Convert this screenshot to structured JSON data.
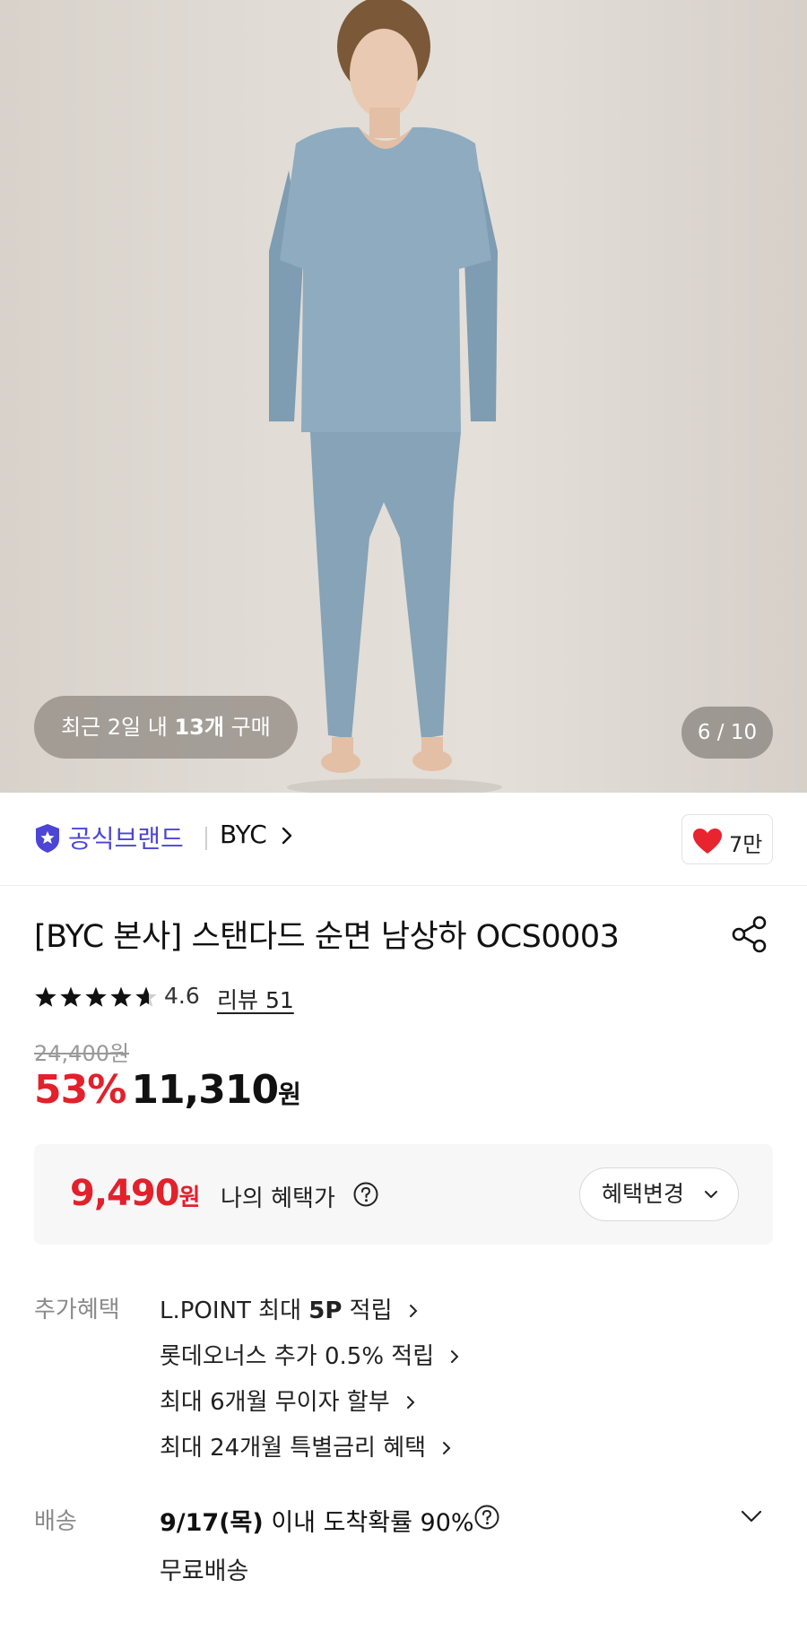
{
  "hero": {
    "recent_prefix": "최근 2일 내 ",
    "recent_count": "13개",
    "recent_suffix": " 구매",
    "page_indicator": "6 / 10"
  },
  "brand": {
    "official_label": "공식브랜드",
    "name": "BYC",
    "like_count": "7만"
  },
  "product": {
    "title": "[BYC 본사] 스탠다드 순면 남상하 OCS0003",
    "rating": "4.6",
    "rating_value": 4.6,
    "review_label": "리뷰 51",
    "original_price": "24,400원",
    "discount_percent": "53%",
    "sale_price": "11,310",
    "currency": "원"
  },
  "benefit": {
    "my_price": "9,490",
    "currency": "원",
    "my_price_label": "나의 혜택가",
    "change_button": "혜택변경"
  },
  "extra_benefits": {
    "label": "추가혜택",
    "items": [
      {
        "pre": "L.POINT 최대 ",
        "bold": "5P",
        "post": " 적립"
      },
      {
        "pre": "롯데오너스 추가 0.5% 적립",
        "bold": "",
        "post": ""
      },
      {
        "pre": "최대 6개월 무이자 할부",
        "bold": "",
        "post": ""
      },
      {
        "pre": "최대 24개월 특별금리 혜택",
        "bold": "",
        "post": ""
      }
    ]
  },
  "shipping": {
    "label": "배송",
    "date": "9/17(목)",
    "probability_text": " 이내 도착확률 90%",
    "fee": "무료배송"
  },
  "colors": {
    "brand_purple": "#4c45d6",
    "sale_red": "#e2212b",
    "heart_red": "#e8242e"
  }
}
